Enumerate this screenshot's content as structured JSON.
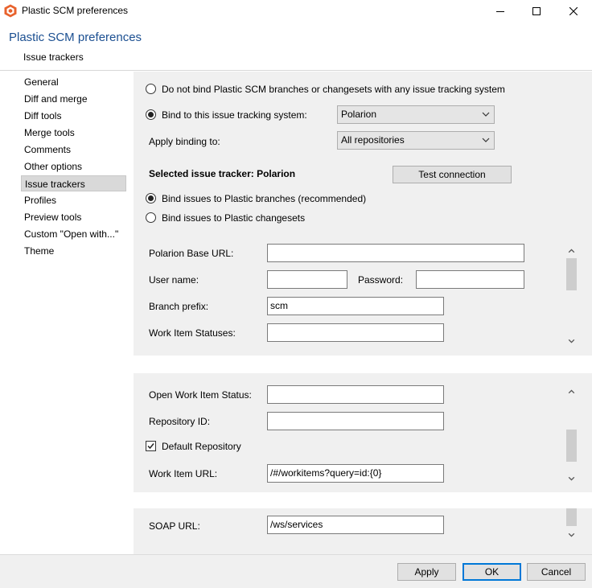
{
  "window": {
    "title": "Plastic SCM preferences"
  },
  "header": {
    "title": "Plastic SCM preferences",
    "subtitle": "Issue trackers"
  },
  "sidebar": {
    "items": [
      {
        "label": "General"
      },
      {
        "label": "Diff and merge"
      },
      {
        "label": "Diff tools"
      },
      {
        "label": "Merge tools"
      },
      {
        "label": "Comments"
      },
      {
        "label": "Other options"
      },
      {
        "label": "Issue trackers",
        "selected": true
      },
      {
        "label": "Profiles"
      },
      {
        "label": "Preview tools"
      },
      {
        "label": "Custom \"Open with...\""
      },
      {
        "label": "Theme"
      }
    ]
  },
  "binding": {
    "no_bind_label": "Do not bind Plastic SCM branches or changesets with any issue tracking system",
    "bind_label": "Bind to this issue tracking system:",
    "tracker_value": "Polarion",
    "apply_binding_label": "Apply binding to:",
    "apply_binding_value": "All repositories",
    "selected_tracker_label": "Selected issue tracker: Polarion",
    "test_connection_label": "Test connection",
    "bind_branches_label": "Bind issues to Plastic branches (recommended)",
    "bind_changesets_label": "Bind issues to Plastic changesets"
  },
  "fields": {
    "base_url_label": "Polarion Base URL:",
    "base_url_value": "",
    "username_label": "User name:",
    "username_value": "",
    "password_label": "Password:",
    "password_value": "",
    "branch_prefix_label": "Branch prefix:",
    "branch_prefix_value": "scm",
    "statuses_label": "Work Item Statuses:",
    "statuses_value": "",
    "open_status_label": "Open Work Item Status:",
    "open_status_value": "",
    "repo_id_label": "Repository ID:",
    "repo_id_value": "",
    "default_repo_label": "Default Repository",
    "work_item_url_label": "Work Item URL:",
    "work_item_url_value": "/#/workitems?query=id:{0}",
    "soap_url_label": "SOAP URL:",
    "soap_url_value": "/ws/services"
  },
  "footer": {
    "apply_label": "Apply",
    "ok_label": "OK",
    "cancel_label": "Cancel"
  },
  "colors": {
    "header_title": "#1b4f91",
    "app_icon": "#e8622c",
    "default_button_border": "#0078d7"
  }
}
